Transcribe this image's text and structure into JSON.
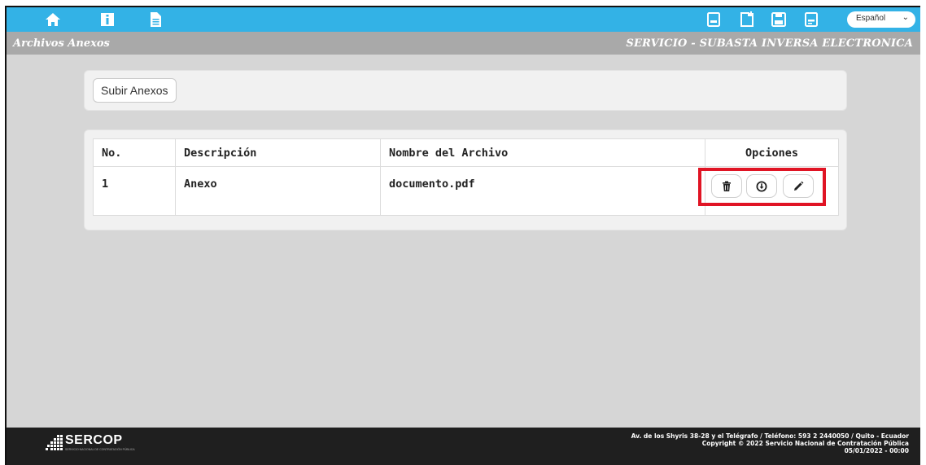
{
  "topbar": {
    "left_icons": [
      "home-icon",
      "info-icon",
      "document-icon"
    ],
    "right_icons": [
      "pdf-icon",
      "new-page-icon",
      "save-icon",
      "pdf-export-icon"
    ],
    "language": "Español",
    "color": "#33b2e6"
  },
  "titlebar": {
    "title": "Archivos Anexos",
    "service": "SERVICIO - SUBASTA INVERSA ELECTRONICA"
  },
  "upload": {
    "label": "Subir Anexos"
  },
  "table": {
    "headers": {
      "no": "No.",
      "desc": "Descripción",
      "file": "Nombre del Archivo",
      "options": "Opciones"
    },
    "rows": [
      {
        "no": "1",
        "desc": "Anexo",
        "file": "documento.pdf"
      }
    ],
    "option_icons": [
      "trash-icon",
      "download-icon",
      "edit-icon"
    ],
    "highlight_color": "#e01424"
  },
  "footer": {
    "logo": "SERCOP",
    "logo_sub": "SERVICIO NACIONAL DE CONTRATACIÓN PÚBLICA",
    "address": "Av. de los Shyris 38-28 y el Telégrafo / Teléfono: 593 2 2440050 / Quito - Ecuador",
    "copyright": "Copyright © 2022 Servicio Nacional de Contratación Pública",
    "date": "05/01/2022 - 00:00"
  }
}
